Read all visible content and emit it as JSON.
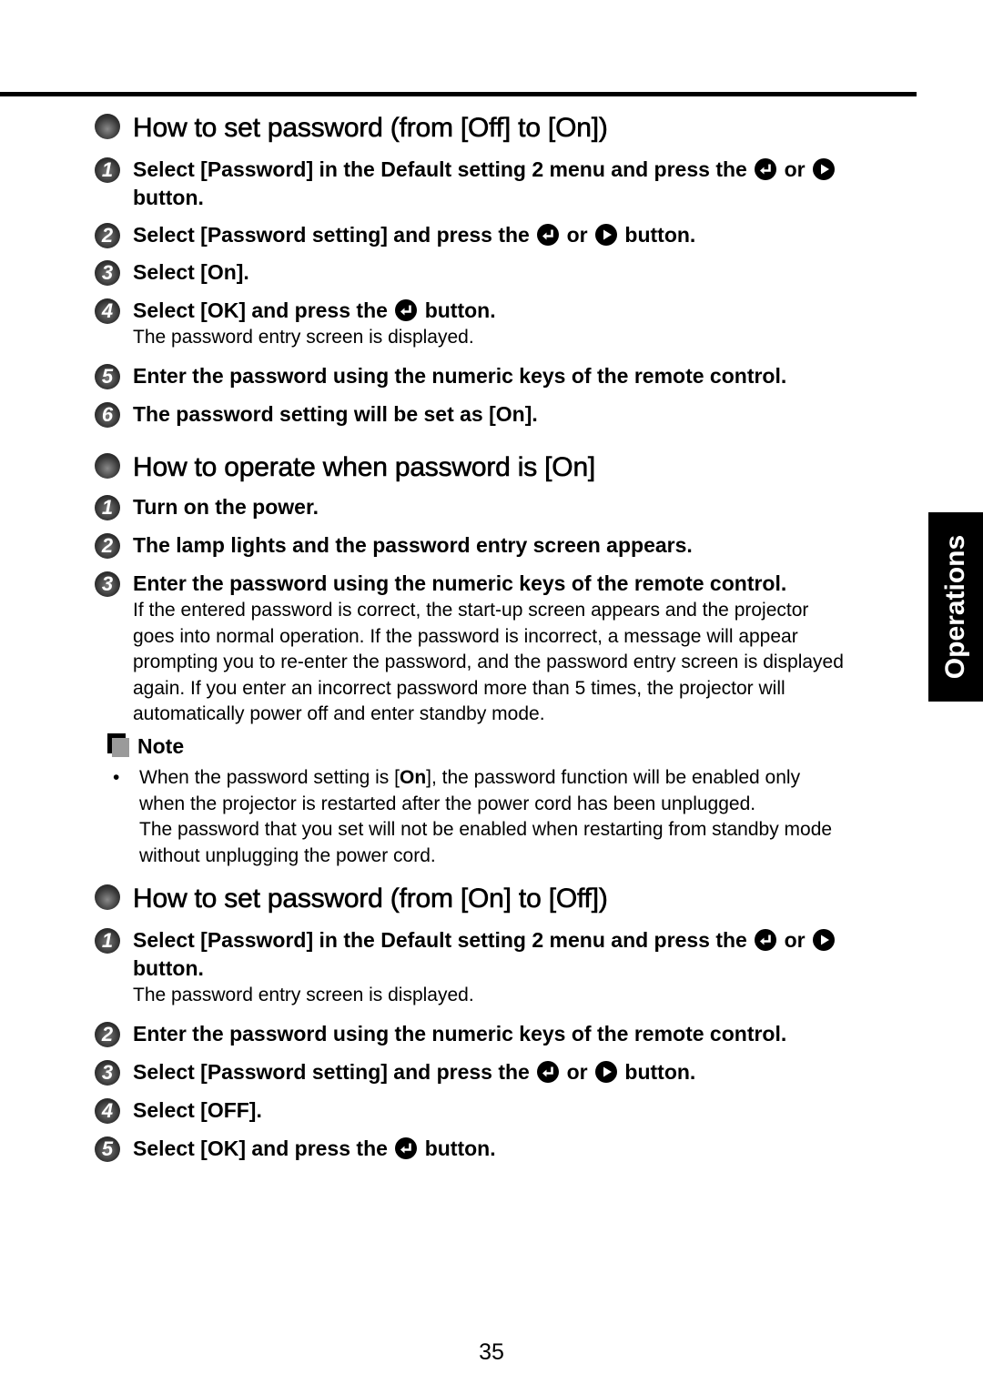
{
  "side_tab": {
    "label": "Operations"
  },
  "sections": [
    {
      "heading": "How to set password (from [Off] to [On])",
      "steps": [
        {
          "num": "1",
          "text_a": "Select [Password] in the Default setting 2 menu and press the",
          "icon1": "enter-button-icon",
          "or": "or",
          "icon2": "right-arrow-button-icon",
          "text_b": "button."
        },
        {
          "num": "2",
          "text_a": "Select [Password setting] and press the",
          "icon1": "enter-button-icon",
          "or": "or",
          "icon2": "right-arrow-button-icon",
          "text_b": "button."
        },
        {
          "num": "3",
          "text": "Select [On]."
        },
        {
          "num": "4",
          "text_a": "Select [OK] and press the",
          "icon1": "enter-button-icon",
          "text_b": "button.",
          "sub": "The password entry screen is displayed."
        },
        {
          "num": "5",
          "text": "Enter the password using the numeric keys of the remote control."
        },
        {
          "num": "6",
          "text": "The password setting will be set as [On]."
        }
      ]
    },
    {
      "heading": "How to operate when password is [On]",
      "steps": [
        {
          "num": "1",
          "text": "Turn on the power."
        },
        {
          "num": "2",
          "text": "The lamp lights and the password entry screen appears."
        },
        {
          "num": "3",
          "text": "Enter the password using the numeric keys of the remote control.",
          "sub_lines": [
            "If the entered password is correct, the start-up screen appears and the projector",
            "goes into normal operation. If the password is incorrect, a message will appear",
            "prompting you to re-enter the password, and the password entry screen is displayed",
            "again. If you enter an incorrect password more than 5 times, the projector will",
            "automatically power off and enter standby mode."
          ]
        }
      ]
    },
    {
      "heading": "How to set password (from [On] to [Off])",
      "steps": [
        {
          "num": "1",
          "text_a": "Select [Password] in the Default setting 2 menu and press the",
          "icon1": "enter-button-icon",
          "or": "or",
          "icon2": "right-arrow-button-icon",
          "text_b": "button.",
          "sub": "The password entry screen is displayed."
        },
        {
          "num": "2",
          "text": "Enter the password using the numeric keys of the remote control."
        },
        {
          "num": "3",
          "text_a": "Select [Password setting] and press the",
          "icon1": "enter-button-icon",
          "or": "or",
          "icon2": "right-arrow-button-icon",
          "text_b": "button."
        },
        {
          "num": "4",
          "text": "Select [OFF]."
        },
        {
          "num": "5",
          "text_a": "Select [OK] and press the",
          "icon1": "enter-button-icon",
          "text_b": "button."
        }
      ]
    }
  ],
  "note": {
    "title": "Note",
    "bullet": "•",
    "line1_pre": "When the password setting is [",
    "line1_bold": "On",
    "line1_post": "], the password function will be enabled only",
    "line2": "when the projector is restarted after the power cord has been unplugged.",
    "line3": "The password that you set will not be enabled when restarting from standby mode",
    "line4": "without unplugging the power cord."
  },
  "page_number": "35"
}
